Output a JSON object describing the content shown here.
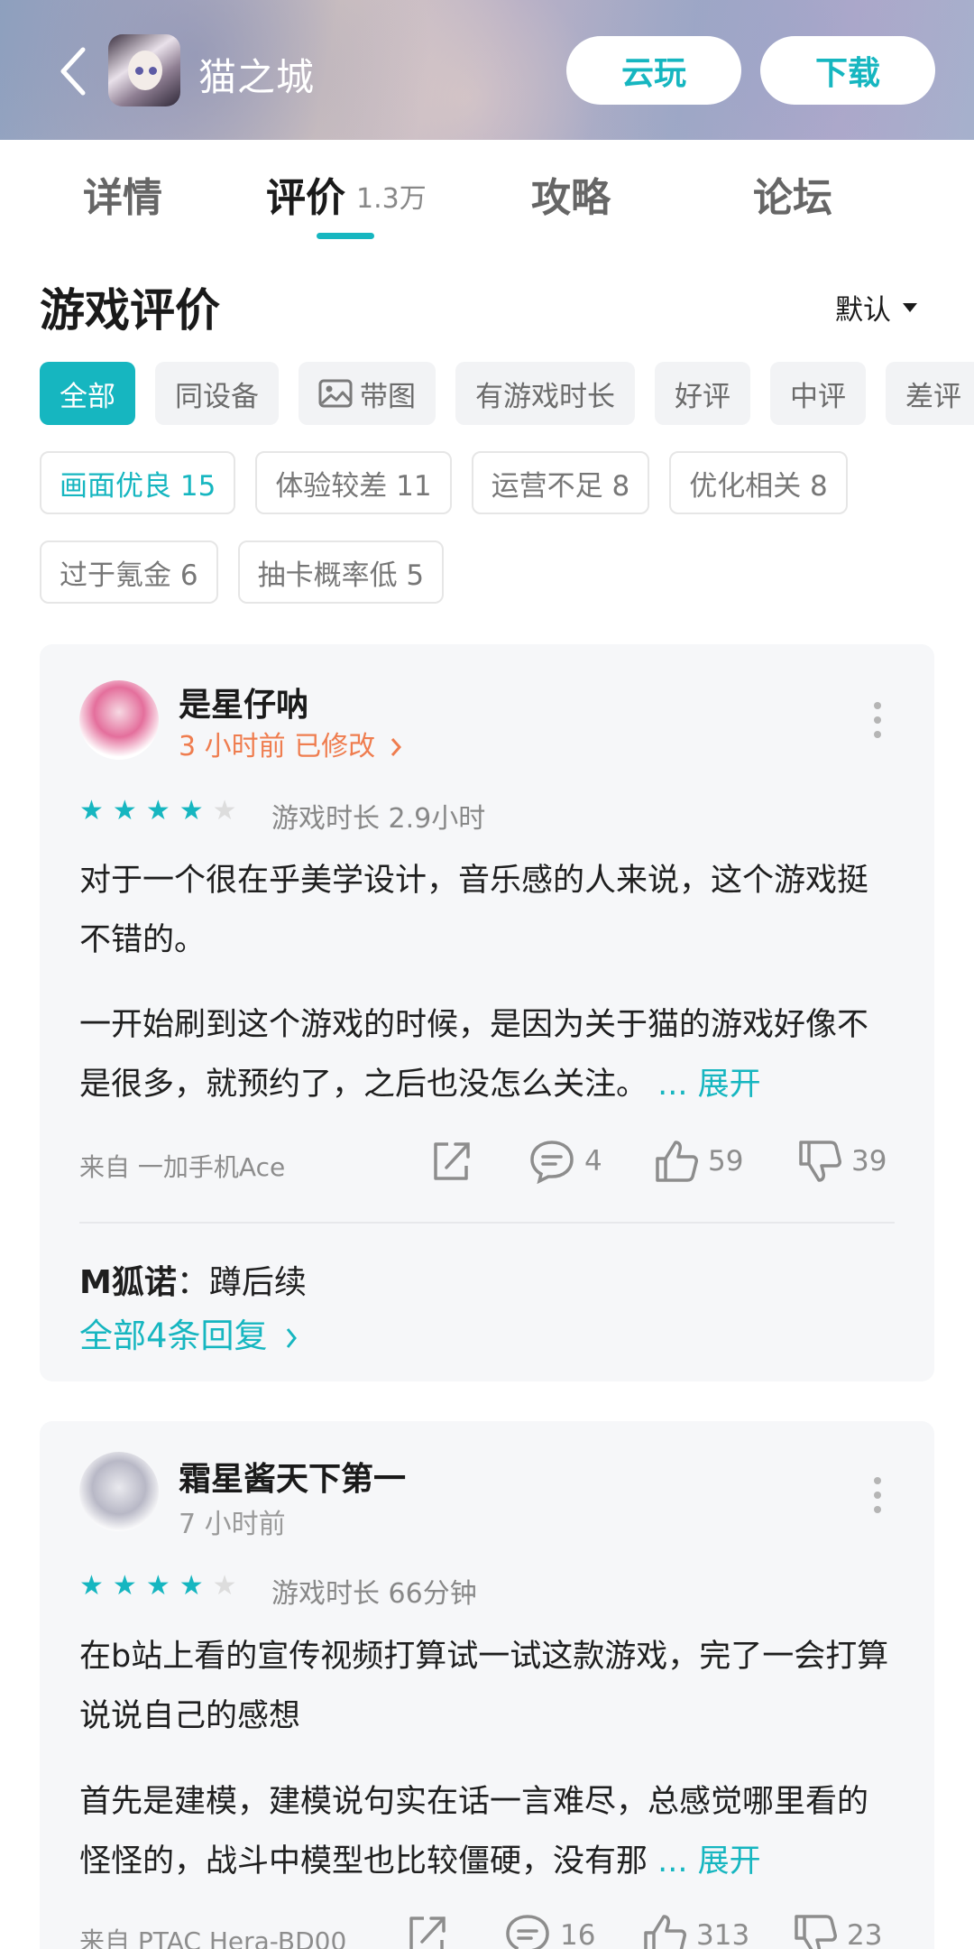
{
  "header": {
    "title": "猫之城",
    "cloud_play_label": "云玩",
    "download_label": "下载",
    "back_icon": "chevron-left-icon",
    "accent_color": "#16b6c0"
  },
  "tabs": [
    {
      "label": "详情"
    },
    {
      "label": "评价",
      "count": "1.3万",
      "active": true
    },
    {
      "label": "攻略"
    },
    {
      "label": "论坛"
    }
  ],
  "section": {
    "title": "游戏评价",
    "sort_label": "默认"
  },
  "filters": [
    {
      "label": "全部",
      "active": true
    },
    {
      "label": "同设备"
    },
    {
      "label": "带图",
      "icon": "image-icon"
    },
    {
      "label": "有游戏时长"
    },
    {
      "label": "好评"
    },
    {
      "label": "中评"
    },
    {
      "label": "差评"
    }
  ],
  "tags": [
    {
      "label": "画面优良 15",
      "active": true
    },
    {
      "label": "体验较差 11"
    },
    {
      "label": "运营不足 8"
    },
    {
      "label": "优化相关 8"
    },
    {
      "label": "过于氪金 6"
    },
    {
      "label": "抽卡概率低 5"
    }
  ],
  "reviews": [
    {
      "username": "是星仔呐",
      "time": "3 小时前 已修改",
      "rating": 4,
      "max_rating": 5,
      "playtime": "游戏时长 2.9小时",
      "paragraph1": "对于一个很在乎美学设计，音乐感的人来说，这个游戏挺不错的。",
      "paragraph2": "一开始刷到这个游戏的时候，是因为关于猫的游戏好像不是很多，就预约了，之后也没怎么关注。",
      "expand_label": "... 展开",
      "source": "来自 一加手机Ace",
      "comments": "4",
      "likes": "59",
      "dislikes": "39",
      "reply_author": "M狐诺",
      "reply_text": "：蹲后续",
      "all_replies": "全部4条回复"
    },
    {
      "username": "霜星酱天下第一",
      "time": "7 小时前",
      "rating": 4,
      "max_rating": 5,
      "playtime": "游戏时长 66分钟",
      "paragraph1": "在b站上看的宣传视频打算试一试这款游戏，完了一会打算说说自己的感想",
      "paragraph2": "首先是建模，建模说句实在话一言难尽，总感觉哪里看的怪怪的，战斗中模型也比较僵硬，没有那",
      "expand_label": "... 展开",
      "source": "来自 PTAC Hera-BD00",
      "comments": "16",
      "likes": "313",
      "dislikes": "23"
    }
  ]
}
